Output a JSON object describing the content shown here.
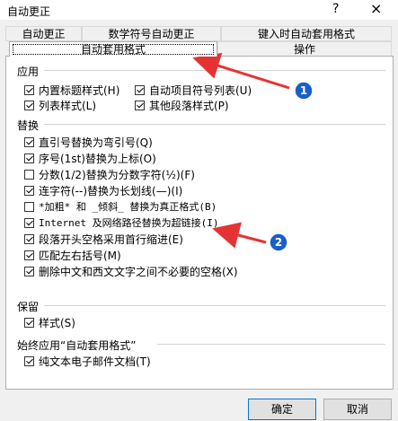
{
  "window": {
    "title": "自动更正",
    "help": "?",
    "close": "×"
  },
  "tabs": {
    "row1": [
      "自动更正",
      "数学符号自动更正",
      "键入时自动套用格式"
    ],
    "row2": {
      "active": "自动套用格式",
      "other": "操作"
    }
  },
  "groups": {
    "apply": {
      "title": "应用",
      "items": [
        {
          "label": "内置标题样式(H)",
          "checked": true
        },
        {
          "label": "自动项目符号列表(U)",
          "checked": true
        },
        {
          "label": "列表样式(L)",
          "checked": true
        },
        {
          "label": "其他段落样式(P)",
          "checked": true
        }
      ]
    },
    "replace": {
      "title": "替换",
      "items": [
        {
          "label": "直引号替换为弯引号(Q)",
          "checked": true
        },
        {
          "label": "序号(1st)替换为上标(O)",
          "checked": true
        },
        {
          "label": "分数(1/2)替换为分数字符(½)(F)",
          "checked": false
        },
        {
          "label": "连字符(--)替换为长划线(—)(I)",
          "checked": true
        },
        {
          "label": "*加粗* 和 _倾斜_ 替换为真正格式(B)",
          "checked": false
        },
        {
          "label": "Internet 及网络路径替换为超链接(I)",
          "checked": true
        },
        {
          "label": "段落开头空格采用首行缩进(E)",
          "checked": true
        },
        {
          "label": "匹配左右括号(M)",
          "checked": true
        },
        {
          "label": "删除中文和西文文字之间不必要的空格(X)",
          "checked": true
        }
      ]
    },
    "preserve": {
      "title": "保留",
      "items": [
        {
          "label": "样式(S)",
          "checked": true
        }
      ]
    },
    "always": {
      "title": "始终应用“自动套用格式”",
      "items": [
        {
          "label": "纯文本电子邮件文档(T)",
          "checked": true
        }
      ]
    }
  },
  "buttons": {
    "ok": "确定",
    "cancel": "取消"
  },
  "annotations": {
    "marker1": "1",
    "marker2": "2"
  },
  "colors": {
    "arrow": "#e53333",
    "marker": "#1a5fc7",
    "accent": "#0078d7"
  }
}
